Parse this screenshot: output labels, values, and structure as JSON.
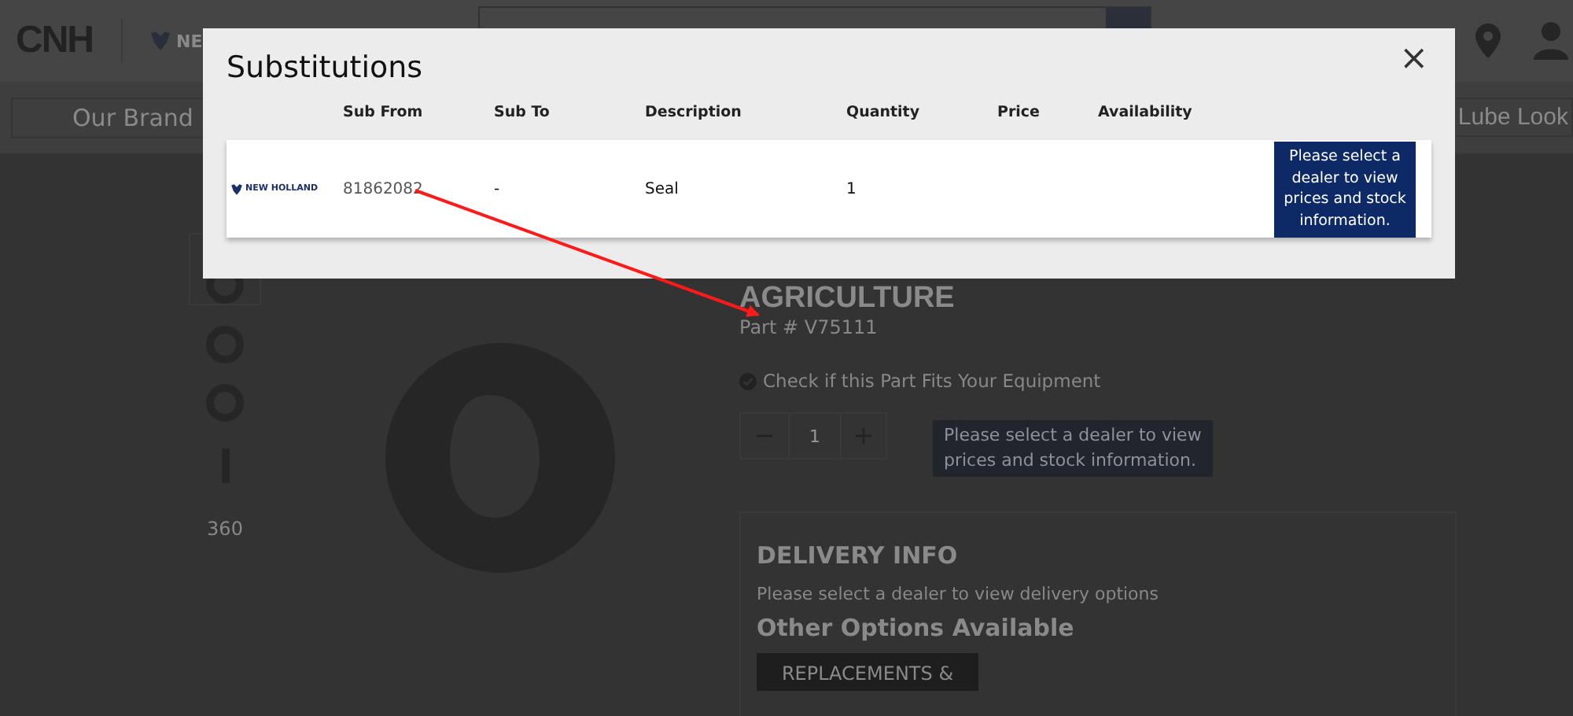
{
  "header": {
    "logo": "CNH",
    "brand_text": "NE",
    "nav_items": [
      "Our Brand",
      "Lube Look"
    ]
  },
  "product": {
    "thumbnail_label": "360",
    "category": "AGRICULTURE",
    "part_number": "Part # V75111",
    "fit_check": "Check if this Part Fits Your Equipment",
    "quantity": "1",
    "dealer_notice": "Please select a dealer to view prices and stock information.",
    "delivery": {
      "title": "DELIVERY INFO",
      "text": "Please select a dealer to view delivery options",
      "options_title": "Other Options Available",
      "button": "REPLACEMENTS &"
    }
  },
  "modal": {
    "title": "Substitutions",
    "close": "×",
    "columns": [
      "Sub From",
      "Sub To",
      "Description",
      "Quantity",
      "Price",
      "Availability"
    ],
    "rows": [
      {
        "brand": "NEW HOLLAND",
        "sub_from": "81862082",
        "sub_to": "-",
        "description": "Seal",
        "quantity": "1",
        "action": "Please select a dealer to view prices and stock information."
      }
    ]
  }
}
